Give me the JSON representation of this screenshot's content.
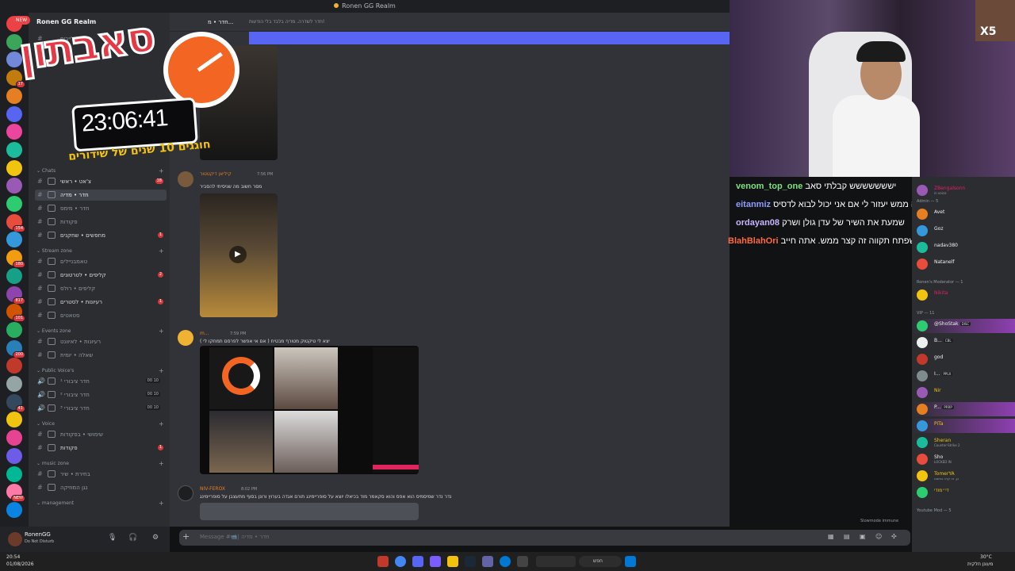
{
  "window": {
    "title": "Ronen GG Realm"
  },
  "overlay": {
    "badge": "NEW",
    "title": "סאבתון",
    "timer": "23:06:41",
    "subtitle": "חוגגים 10 שנים של שידורים",
    "multiplier": "X5"
  },
  "server": {
    "name": "Ronen GG Realm"
  },
  "rail_badges": [
    "17",
    "154",
    "180",
    "817",
    "101",
    "200",
    "41",
    "NEW"
  ],
  "sidebar": {
    "top_channels": [
      {
        "label": "חדר לייבים"
      }
    ],
    "categories": [
      {
        "label": "Chats",
        "channels": [
          {
            "label": "צ'אט • ראשי",
            "badge": "18"
          },
          {
            "label": "חדר • מדיה",
            "active": true
          },
          {
            "label": "חדר • מימס"
          },
          {
            "label": "פקודות"
          },
          {
            "label": "מחפשים • שחקנים",
            "badge": "1"
          }
        ]
      },
      {
        "label": "Stream zone",
        "channels": [
          {
            "label": "טאמבניילים"
          },
          {
            "label": "קליפים • לטרטונים",
            "badge": "2"
          },
          {
            "label": "קליפים • רולס"
          },
          {
            "label": "רעיונות • לסטרים",
            "badge": "1"
          },
          {
            "label": "סטאטים"
          }
        ]
      },
      {
        "label": "Events zone",
        "channels": [
          {
            "label": "רעיונות • לאיוונט"
          },
          {
            "label": "שאלה • יומית"
          }
        ]
      },
      {
        "label": "Public Voice's",
        "channels": [
          {
            "label": "חדר ציבורי ¹",
            "vc": "00 10"
          },
          {
            "label": "חדר ציבורי ²",
            "vc": "00 10"
          },
          {
            "label": "חדר ציבורי ³",
            "vc": "00 10"
          }
        ]
      },
      {
        "label": "Voice",
        "channels": [
          {
            "label": "שימושי • בפקודות"
          },
          {
            "label": "פקודות",
            "badge": "1"
          }
        ]
      },
      {
        "label": "music zone",
        "channels": [
          {
            "label": "בחירת • שיר"
          },
          {
            "label": "נגן המוזיקה"
          }
        ]
      },
      {
        "label": "management",
        "channels": []
      }
    ]
  },
  "user": {
    "name": "RonenGG",
    "status": "Do Not Disturb"
  },
  "chat": {
    "channel": "חדר • מ...",
    "topic": "חדר לשדרה. מדיה בלבד בלי הודעות!",
    "messages": [
      {
        "author": "קיליאן דיקטטור",
        "time": "7:56 PM",
        "text": "מסר חשוב מה שניסיתי להסביר"
      },
      {
        "author": "m...",
        "time": "7:59 PM",
        "text": "יצא לי טיקטוק מטורף מבטיח ( אם אי אפשר לפרסם תמחקו לי )"
      },
      {
        "author": "NIV-FEROX",
        "time": "8:02 PM",
        "text": "נדר נדר שמיסמיס הוא אפס והוא סקאמר מוד בכיאלו יוצא על סופריימינג תורם אגדה בערוץ ורונן בסוף מתעצבן על סופריימינג"
      }
    ],
    "composer_placeholder": "Message #📹| חדר • מדיה",
    "slowmode": "Slowmode immune"
  },
  "stream_chat": [
    {
      "user": "venom_top_one",
      "text": "יששששששש קבלתי סאב",
      "color": "#7ee081"
    },
    {
      "user": "eitanmiz",
      "text": "אני סטרמר חדש זה ממש יעזור לי אם אני יכול לבוא לדסיס",
      "color": "#8f9cff"
    },
    {
      "user": "ordayan08",
      "text": "שמעת את השיר של עדן גולן ושרק",
      "color": "#c8b6ff"
    },
    {
      "user": "BlahBlahOri",
      "text": "סיפור שלך היה את הראשון שפתח תקווה זה קצר ממש. אתה חייב",
      "color": "#ff6a3d"
    }
  ],
  "members": {
    "top": [
      {
        "name": "ZBengalsonn",
        "status": "in voice",
        "color": "#e91e63"
      }
    ],
    "groups": [
      {
        "label": "Admin — 5",
        "members": [
          {
            "name": "Avet",
            "color": "#f2f3f5"
          },
          {
            "name": "Goz",
            "color": "#f2f3f5"
          },
          {
            "name": "nadav380",
            "color": "#f2f3f5"
          },
          {
            "name": "Natanelf",
            "color": "#f2f3f5"
          }
        ]
      },
      {
        "label": "Ronen's Moderator — 1",
        "members": [
          {
            "name": "Nikita",
            "color": "#e91e63"
          }
        ]
      },
      {
        "label": "VIP — 11",
        "members": [
          {
            "name": "@ShoStak",
            "tag": "DISC",
            "color": "#f2f3f5",
            "highlight": true
          },
          {
            "name": "B...",
            "tag": "CBL",
            "color": "#f2f3f5"
          },
          {
            "name": "god",
            "color": "#f2f3f5"
          },
          {
            "name": "I...",
            "tag": "PPLX",
            "color": "#f2f3f5"
          },
          {
            "name": "Nir",
            "color": "#f1c40f"
          },
          {
            "name": "P...",
            "tag": "PRRP",
            "color": "#f2f3f5",
            "highlight": true
          },
          {
            "name": "PiTa",
            "color": "#f1c40f",
            "highlight": true
          },
          {
            "name": "Sheran",
            "status": "Counter-Strike 2",
            "color": "#f1c40f"
          },
          {
            "name": "Sho",
            "status": "LOCKED IN",
            "color": "#f2f3f5"
          },
          {
            "name": "TomerYA",
            "status": "כן, זה קרה בפוסט",
            "color": "#f1c40f"
          },
          {
            "name": "די״מודי",
            "color": "#f1c40f"
          }
        ]
      },
      {
        "label": "Youtube Mod — 5",
        "members": []
      }
    ]
  },
  "taskbar": {
    "time": "20:54",
    "date": "01/08/2026",
    "weather": "30°C",
    "weather_desc": "מעונן חלקית",
    "search": "חפש"
  }
}
